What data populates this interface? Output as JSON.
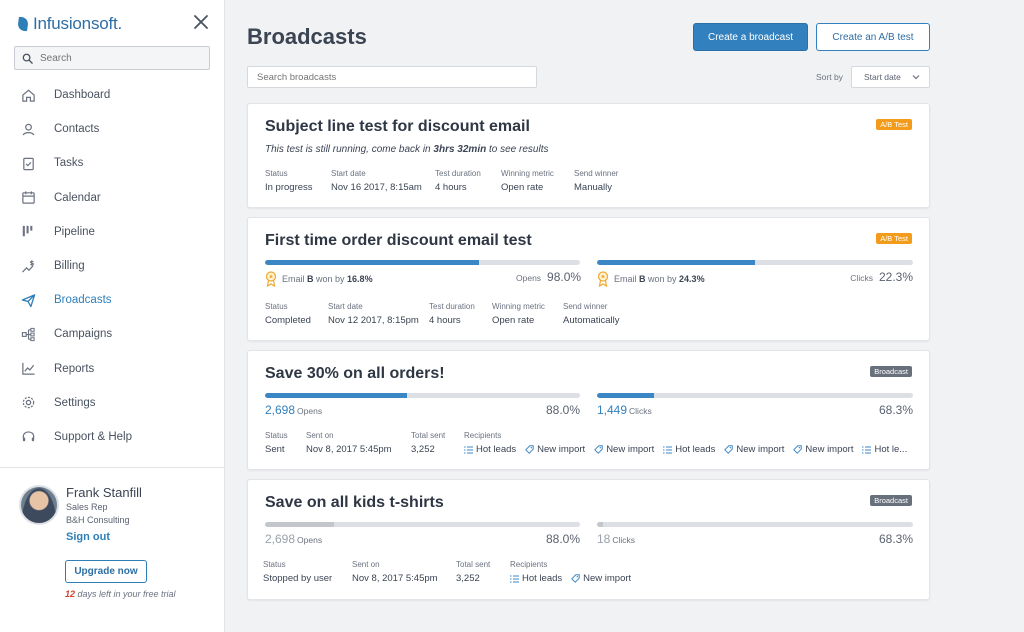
{
  "brand": {
    "name": "Infusionsoft."
  },
  "sidebar": {
    "search_placeholder": "Search",
    "items": [
      {
        "label": "Dashboard",
        "icon": "home-icon"
      },
      {
        "label": "Contacts",
        "icon": "person-icon"
      },
      {
        "label": "Tasks",
        "icon": "clipboard-check-icon"
      },
      {
        "label": "Calendar",
        "icon": "calendar-icon"
      },
      {
        "label": "Pipeline",
        "icon": "pipeline-icon"
      },
      {
        "label": "Billing",
        "icon": "billing-icon"
      },
      {
        "label": "Broadcasts",
        "icon": "paper-plane-icon",
        "active": true
      },
      {
        "label": "Campaigns",
        "icon": "campaign-flow-icon"
      },
      {
        "label": "Reports",
        "icon": "line-chart-icon"
      },
      {
        "label": "Settings",
        "icon": "gear-icon"
      },
      {
        "label": "Support & Help",
        "icon": "headset-icon"
      }
    ]
  },
  "profile": {
    "name": "Frank Stanfill",
    "role": "Sales Rep",
    "company": "B&H Consulting",
    "signout": "Sign out",
    "upgrade": "Upgrade now",
    "trial_days": "12",
    "trial_text": " days left in your free trial"
  },
  "header": {
    "title": "Broadcasts",
    "create_broadcast": "Create a broadcast",
    "create_ab": "Create an A/B test",
    "search_placeholder": "Search broadcasts",
    "sort_label": "Sort by",
    "sort_value": "Start date"
  },
  "colors": {
    "accent": "#3280bd",
    "ab_badge": "#f39c1c",
    "broadcast_badge": "#68707c"
  },
  "cards": [
    {
      "title": "Subject line test for discount email",
      "badge": "A/B Test",
      "running_pre": "This test is still running, come back in ",
      "running_time": "3hrs 32min",
      "running_post": " to see results",
      "meta": [
        {
          "label": "Status",
          "value": "In progress"
        },
        {
          "label": "Start date",
          "value": "Nov 16 2017, 8:15am"
        },
        {
          "label": "Test duration",
          "value": "4 hours"
        },
        {
          "label": "Winning metric",
          "value": "Open rate"
        },
        {
          "label": "Send winner",
          "value": "Manually"
        }
      ]
    },
    {
      "title": "First time order discount email test",
      "badge": "A/B Test",
      "opens": {
        "winner_pre": "Email ",
        "variant": "B",
        "winner_mid": " won by ",
        "margin": "16.8%",
        "label": "Opens",
        "pct": "98.0%",
        "fill": 0.68
      },
      "clicks": {
        "winner_pre": "Email ",
        "variant": "B",
        "winner_mid": " won by ",
        "margin": "24.3%",
        "label": "Clicks",
        "pct": "22.3%",
        "fill": 0.5
      },
      "meta": [
        {
          "label": "Status",
          "value": "Completed"
        },
        {
          "label": "Start date",
          "value": "Nov 12 2017, 8:15pm"
        },
        {
          "label": "Test duration",
          "value": "4 hours"
        },
        {
          "label": "Winning metric",
          "value": "Open rate"
        },
        {
          "label": "Send winner",
          "value": "Automatically"
        }
      ]
    },
    {
      "title": "Save 30% on all orders!",
      "badge": "Broadcast",
      "opens": {
        "count": "2,698",
        "label": "Opens",
        "pct": "88.0%",
        "fill": 0.45
      },
      "clicks": {
        "count": "1,449",
        "label": "Clicks",
        "pct": "68.3%",
        "fill": 0.18
      },
      "meta": [
        {
          "label": "Status",
          "value": "Sent"
        },
        {
          "label": "Sent on",
          "value": "Nov 8, 2017 5:45pm"
        },
        {
          "label": "Total sent",
          "value": "3,252"
        }
      ],
      "recipients_label": "Recipients",
      "recipients": [
        {
          "type": "list",
          "label": "Hot leads"
        },
        {
          "type": "tag",
          "label": "New import"
        },
        {
          "type": "tag",
          "label": "New import"
        },
        {
          "type": "list",
          "label": "Hot leads"
        },
        {
          "type": "tag",
          "label": "New import"
        },
        {
          "type": "tag",
          "label": "New import"
        },
        {
          "type": "list",
          "label": "Hot le..."
        }
      ]
    },
    {
      "title": "Save on all kids t-shirts",
      "badge": "Broadcast",
      "opens": {
        "count": "2,698",
        "label": "Opens",
        "pct": "88.0%",
        "fill": 0.22
      },
      "clicks": {
        "count": "18",
        "label": "Clicks",
        "pct": "68.3%",
        "fill": 0.02
      },
      "meta": [
        {
          "label": "Status",
          "value": "Stopped by user"
        },
        {
          "label": "Sent on",
          "value": "Nov 8, 2017 5:45pm"
        },
        {
          "label": "Total sent",
          "value": "3,252"
        }
      ],
      "recipients_label": "Recipients",
      "recipients": [
        {
          "type": "list",
          "label": "Hot leads"
        },
        {
          "type": "tag",
          "label": "New import"
        }
      ]
    }
  ]
}
